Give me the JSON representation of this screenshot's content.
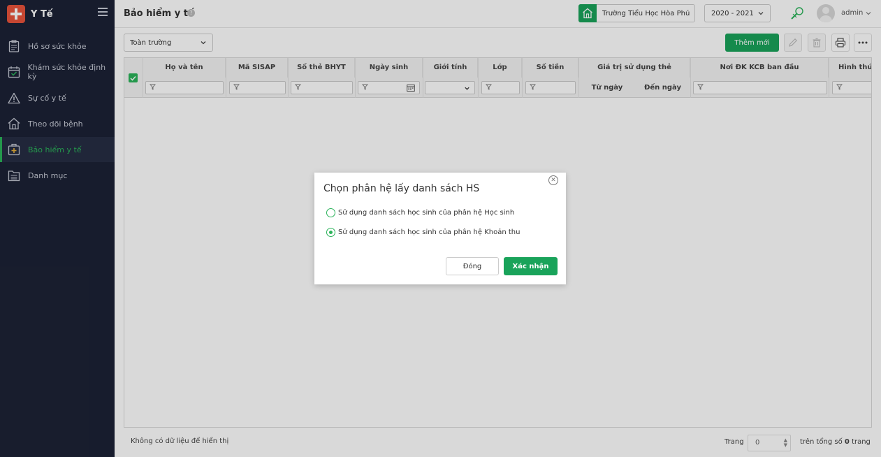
{
  "app": {
    "name": "Y Tế"
  },
  "sidebar": {
    "items": [
      {
        "label": "Hồ sơ sức khỏe",
        "icon": "clipboard-icon"
      },
      {
        "label": "Khám sức khỏe định kỳ",
        "icon": "calendar-check-icon"
      },
      {
        "label": "Sự cố y tế",
        "icon": "warning-icon"
      },
      {
        "label": "Theo dõi bệnh",
        "icon": "home-medical-icon"
      },
      {
        "label": "Bảo hiểm y tế",
        "icon": "medical-case-icon",
        "active": true
      },
      {
        "label": "Danh mục",
        "icon": "folder-list-icon"
      }
    ]
  },
  "header": {
    "title": "Bảo hiểm y tế",
    "help": "?",
    "school": "Trường Tiểu Học Hòa Phú",
    "year": "2020 - 2021",
    "username": "admin"
  },
  "toolbar": {
    "scope": "Toàn trường",
    "add_label": "Thêm mới"
  },
  "grid": {
    "columns": {
      "name": "Họ và tên",
      "sisap": "Mã SISAP",
      "card_no": "Số thẻ BHYT",
      "dob": "Ngày sinh",
      "gender": "Giới tính",
      "class": "Lớp",
      "amount": "Số tiền",
      "validity": "Giá trị sử dụng thẻ",
      "from": "Từ ngày",
      "to": "Đến ngày",
      "register_place": "Nơi ĐK KCB ban đầu",
      "form": "Hình thức"
    }
  },
  "footer": {
    "empty": "Không có dữ liệu để hiển thị",
    "page_label": "Trang",
    "page_value": "0",
    "total_prefix": "trên tổng số",
    "total_pages": "0",
    "total_suffix": "trang"
  },
  "modal": {
    "title": "Chọn phân hệ lấy danh sách HS",
    "options": [
      {
        "label": "Sử dụng danh sách học sinh của phân hệ Học sinh",
        "checked": false
      },
      {
        "label": "Sử dụng danh sách học sinh của phân hệ Khoản thu",
        "checked": true
      }
    ],
    "close_label": "Đóng",
    "confirm_label": "Xác nhận"
  },
  "colors": {
    "accent": "#19a35a",
    "sidebar_bg": "#1c2235",
    "active_text": "#2bb35a"
  }
}
